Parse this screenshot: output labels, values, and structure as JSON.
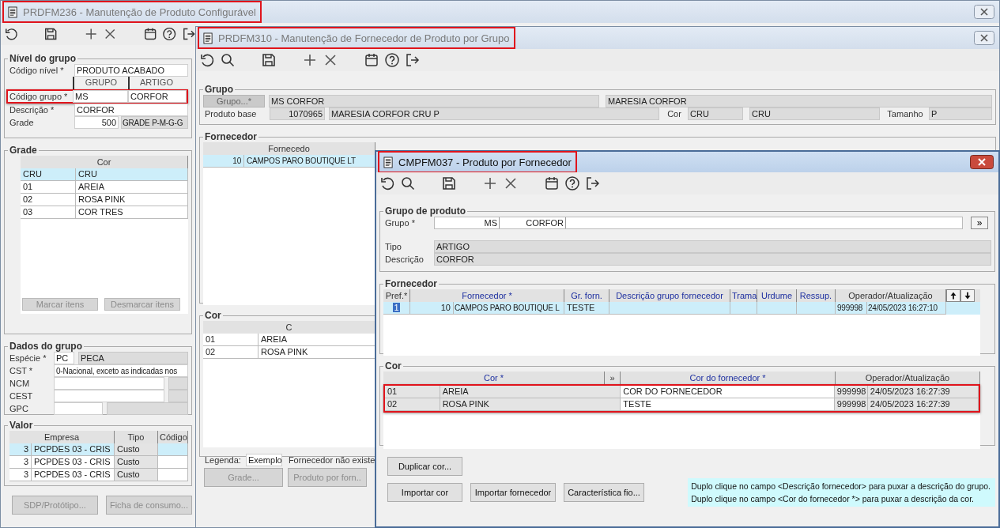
{
  "main_window": {
    "title": "PRDFM236 - Manutenção de Produto Configurável",
    "title_highlighted": true,
    "group_level": {
      "legend": "Nível do grupo",
      "level_label": "Código nível *",
      "level_value": "PRODUTO ACABADO",
      "col_headers": [
        "GRUPO",
        "ARTIGO"
      ],
      "code_label": "Código grupo *",
      "code_values": [
        "MS",
        "CORFOR"
      ],
      "code_highlighted": true,
      "desc_label": "Descrição *",
      "desc_value": "CORFOR",
      "grade_label": "Grade",
      "grade_code": "500",
      "grade_name": "GRADE P-M-G-G"
    },
    "grade": {
      "legend": "Grade",
      "header": "Cor",
      "rows": [
        {
          "code": "CRU",
          "name": "CRU",
          "selected": true
        },
        {
          "code": "01",
          "name": "AREIA",
          "selected": false
        },
        {
          "code": "02",
          "name": "ROSA PINK",
          "selected": false
        },
        {
          "code": "03",
          "name": "COR TRES",
          "selected": false
        }
      ],
      "buttons": [
        {
          "label": "Marcar itens",
          "disabled": true
        },
        {
          "label": "Desmarcar itens",
          "disabled": true
        }
      ]
    },
    "group_data": {
      "legend": "Dados do grupo",
      "species_label": "Espécie *",
      "species_code": "PC",
      "species_name": "PECA",
      "cst_label": "CST *",
      "cst_value": "0-Nacional, exceto as indicadas nos",
      "ncm_label": "NCM",
      "cest_label": "CEST",
      "gpc_label": "GPC"
    },
    "value": {
      "legend": "Valor",
      "columns": [
        "Empresa",
        "Tipo",
        "Código"
      ],
      "rows": [
        {
          "number": "3",
          "company": "PCPDES 03 - CRIS",
          "type": "Custo",
          "selected": true
        },
        {
          "number": "3",
          "company": "PCPDES 03 - CRIS",
          "type": "Custo",
          "selected": false
        },
        {
          "number": "3",
          "company": "PCPDES 03 - CRIS",
          "type": "Custo",
          "selected": false
        }
      ]
    },
    "buttons": [
      {
        "label": "SDP/Protótipo...",
        "disabled": true
      },
      {
        "label": "Ficha de consumo...",
        "disabled": true
      }
    ]
  },
  "supplier_window": {
    "title": "PRDFM310 - Manutenção de Fornecedor de Produto por Grupo",
    "title_highlighted": true,
    "group": {
      "legend": "Grupo",
      "group_button": "Grupo...*",
      "group_value": "MS CORFOR",
      "group_name": "MARESIA CORFOR",
      "base_label": "Produto base",
      "base_code": "1070965",
      "base_name": "MARESIA CORFOR CRU P",
      "color_label": "Cor",
      "color_code": "CRU",
      "color_name": "CRU",
      "size_label": "Tamanho",
      "size_value": "P"
    },
    "supplier": {
      "legend": "Fornecedor",
      "header": "Fornecedo",
      "rows": [
        {
          "code": "10",
          "name": "CAMPOS PARO BOUTIQUE LT",
          "selected": true
        }
      ]
    },
    "color": {
      "legend": "Cor",
      "header": "C",
      "rows": [
        {
          "code": "01",
          "name": "AREIA",
          "selected": false
        },
        {
          "code": "02",
          "name": "ROSA PINK",
          "selected": false
        }
      ]
    },
    "legend_label": "Legenda:",
    "legend_sample": "Exemplo",
    "legend_text": "Fornecedor não existe",
    "buttons": [
      {
        "label": "Grade...",
        "disabled": true
      },
      {
        "label": "Produto por forn..",
        "disabled": true
      }
    ]
  },
  "product_window": {
    "title": "CMPFM037 - Produto por Fornecedor",
    "title_highlighted": true,
    "product_group": {
      "legend": "Grupo de produto",
      "group_label": "Grupo *",
      "group_values": [
        "MS",
        "CORFOR"
      ],
      "more_button": "»",
      "type_label": "Tipo",
      "type_value": "ARTIGO",
      "desc_label": "Descrição",
      "desc_value": "CORFOR"
    },
    "supplier": {
      "legend": "Fornecedor",
      "columns": [
        {
          "label": "Pref.*",
          "editable": false
        },
        {
          "label": "Fornecedor *",
          "editable": true
        },
        {
          "label": "Gr. forn.",
          "editable": true
        },
        {
          "label": "Descrição grupo fornecedor",
          "editable": true
        },
        {
          "label": "Trama",
          "editable": true
        },
        {
          "label": "Urdume",
          "editable": true
        },
        {
          "label": "Ressup.",
          "editable": true
        },
        {
          "label": "Operador/Atualização",
          "editable": false
        }
      ],
      "rows": [
        {
          "pref": "1",
          "code": "10",
          "name": "CAMPOS PARO BOUTIQUE L",
          "group": "TESTE",
          "operator": "999998",
          "updated": "24/05/2023 16:27:10",
          "selected": true
        }
      ]
    },
    "color": {
      "legend": "Cor",
      "columns": [
        {
          "label": "Cor *",
          "editable": true
        },
        {
          "label": "»",
          "editable": false
        },
        {
          "label": "Cor do fornecedor *",
          "editable": true
        },
        {
          "label": "Operador/Atualização",
          "editable": false
        }
      ],
      "highlighted": true,
      "rows": [
        {
          "code": "01",
          "name": "AREIA",
          "supplier_color": "COR DO FORNECEDOR",
          "operator": "999998",
          "updated": "24/05/2023 16:27:39"
        },
        {
          "code": "02",
          "name": "ROSA PINK",
          "supplier_color": "TESTE",
          "operator": "999998",
          "updated": "24/05/2023 16:27:39"
        }
      ]
    },
    "duplicate_button": "Duplicar cor...",
    "buttons": [
      "Importar cor",
      "Importar fornecedor",
      "Característica fio..."
    ],
    "hints": [
      "Duplo clique no campo <Descrição fornecedor> para puxar a descrição do grupo.",
      "Duplo clique no campo <Cor do fornecedor *> para puxar a descrição da cor."
    ]
  }
}
